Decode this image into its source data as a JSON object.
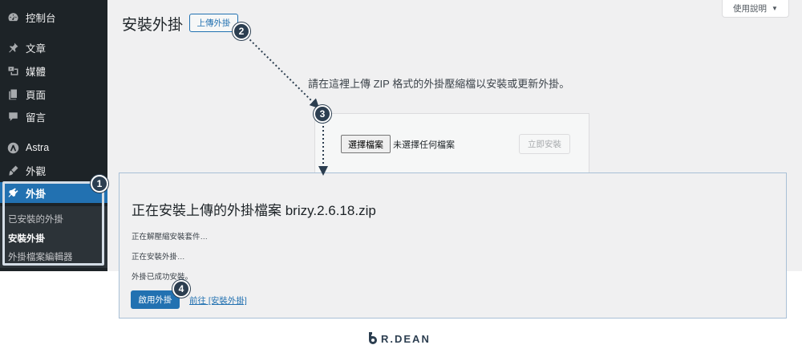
{
  "sidebar": {
    "items": [
      {
        "label": "控制台",
        "icon": "dashboard-icon"
      },
      {
        "label": "文章",
        "icon": "pin-icon"
      },
      {
        "label": "媒體",
        "icon": "media-icon"
      },
      {
        "label": "頁面",
        "icon": "page-icon"
      },
      {
        "label": "留言",
        "icon": "comment-icon"
      },
      {
        "label": "Astra",
        "icon": "astra-icon"
      },
      {
        "label": "外觀",
        "icon": "brush-icon"
      },
      {
        "label": "外掛",
        "icon": "plugin-icon",
        "active": true
      }
    ],
    "submenu": [
      {
        "label": "已安裝的外掛"
      },
      {
        "label": "安裝外掛",
        "current": true
      },
      {
        "label": "外掛檔案編輯器"
      }
    ]
  },
  "header": {
    "title": "安裝外掛",
    "upload_button": "上傳外掛",
    "help_tab": "使用說明"
  },
  "upload": {
    "instructions": "請在這裡上傳 ZIP 格式的外掛壓縮檔以安裝或更新外掛。",
    "choose_file": "選擇檔案",
    "no_file": "未選擇任何檔案",
    "install_now": "立即安裝"
  },
  "install_panel": {
    "title": "正在安裝上傳的外掛檔案 brizy.2.6.18.zip",
    "steps": [
      "正在解壓縮安裝套件…",
      "正在安裝外掛…",
      "外掛已成功安裝。"
    ],
    "activate_button": "啟用外掛",
    "goto_link": "前往 [安裝外掛]"
  },
  "callouts": [
    "1",
    "2",
    "3",
    "4"
  ],
  "logo": {
    "text": "R.DEAN"
  },
  "colors": {
    "accent": "#2271b1",
    "sidebar": "#1d2327",
    "callout": "#2c3e50"
  }
}
